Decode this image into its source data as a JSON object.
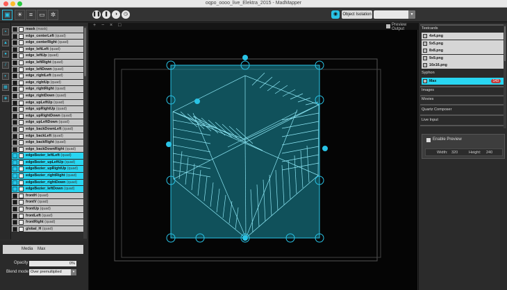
{
  "window": {
    "title": "oqpo_oooo_live_Elektra_2015 - MadMapper"
  },
  "toolbar": {
    "object_isolation_label": "Object Isolation",
    "object_isolation_value": "",
    "select_caret": "▾"
  },
  "layers": [
    {
      "name": "mask",
      "type": "(mask)",
      "selected": false,
      "mask": true
    },
    {
      "name": "edge_centerLeft",
      "type": "(quad)",
      "selected": false
    },
    {
      "name": "edge_centerRight",
      "type": "(quad)",
      "selected": false
    },
    {
      "name": "edge_leftLeft",
      "type": "(quad)",
      "selected": false
    },
    {
      "name": "edge_leftUp",
      "type": "(quad)",
      "selected": false
    },
    {
      "name": "edge_leftRight",
      "type": "(quad)",
      "selected": false
    },
    {
      "name": "edge_leftDown",
      "type": "(quad)",
      "selected": false
    },
    {
      "name": "edge_rightLeft",
      "type": "(quad)",
      "selected": false
    },
    {
      "name": "edge_rightUp",
      "type": "(quad)",
      "selected": false
    },
    {
      "name": "edge_rightRight",
      "type": "(quad)",
      "selected": false
    },
    {
      "name": "edge_rightDown",
      "type": "(quad)",
      "selected": false
    },
    {
      "name": "edge_upLeftUp",
      "type": "(quad)",
      "selected": false
    },
    {
      "name": "edge_upRightUp",
      "type": "(quad)",
      "selected": false
    },
    {
      "name": "edge_upRightDown",
      "type": "(quad)",
      "selected": false
    },
    {
      "name": "edge_upLeftDown",
      "type": "(quad)",
      "selected": false
    },
    {
      "name": "edge_backDownLeft",
      "type": "(quad)",
      "selected": false
    },
    {
      "name": "edge_backLeft",
      "type": "(quad)",
      "selected": false
    },
    {
      "name": "edge_backRight",
      "type": "(quad)",
      "selected": false
    },
    {
      "name": "edge_backDownRight",
      "type": "(quad)",
      "selected": false
    },
    {
      "name": "edgeBezier_leftLeft",
      "type": "(quad)",
      "selected": true
    },
    {
      "name": "edgeBezier_upLeftUp",
      "type": "(quad)",
      "selected": true
    },
    {
      "name": "edgeBezier_upRightUp",
      "type": "(quad)",
      "selected": true
    },
    {
      "name": "edgeBezier_rightRight",
      "type": "(quad)",
      "selected": true
    },
    {
      "name": "edgeBezier_rightDown",
      "type": "(quad)",
      "selected": true
    },
    {
      "name": "edgeBezier_leftDown",
      "type": "(quad)",
      "selected": true
    },
    {
      "name": "frontH",
      "type": "(quad)",
      "selected": false
    },
    {
      "name": "frontV",
      "type": "(quad)",
      "selected": false
    },
    {
      "name": "frontUp",
      "type": "(quad)",
      "selected": false
    },
    {
      "name": "frontLeft",
      "type": "(quad)",
      "selected": false
    },
    {
      "name": "frontRight",
      "type": "(quad)",
      "selected": false
    },
    {
      "name": "global_H",
      "type": "(quad)",
      "selected": false
    }
  ],
  "properties": {
    "media_label": "Media",
    "media_value": "Max",
    "opacity_label": "Opacity",
    "opacity_value": "0%",
    "blend_label": "Blend mode",
    "blend_value": "Over premultiplied"
  },
  "canvas": {
    "head_icons": [
      "+",
      "−",
      "×",
      "□"
    ],
    "preview_output_label": "Preview Output"
  },
  "media_panel": {
    "testcards_label": "Testcards",
    "testcards": [
      "4x4.png",
      "5x5.png",
      "8x8.png",
      "9x9.png",
      "16x16.png"
    ],
    "syphon_label": "Syphon",
    "syphon_items": [
      {
        "name": "Max",
        "badge": "143"
      }
    ],
    "images_label": "Images",
    "movies_label": "Movies",
    "quartz_label": "Quartz Composer",
    "live_input_label": "Live Input"
  },
  "preview": {
    "enable_label": "Enable Preview",
    "width_label": "Width:",
    "width_value": "320",
    "height_label": "Height:",
    "height_value": "240"
  },
  "colors": {
    "accent": "#29c3e6",
    "selected_row": "#29d6f2",
    "badge": "#c23b3b"
  }
}
